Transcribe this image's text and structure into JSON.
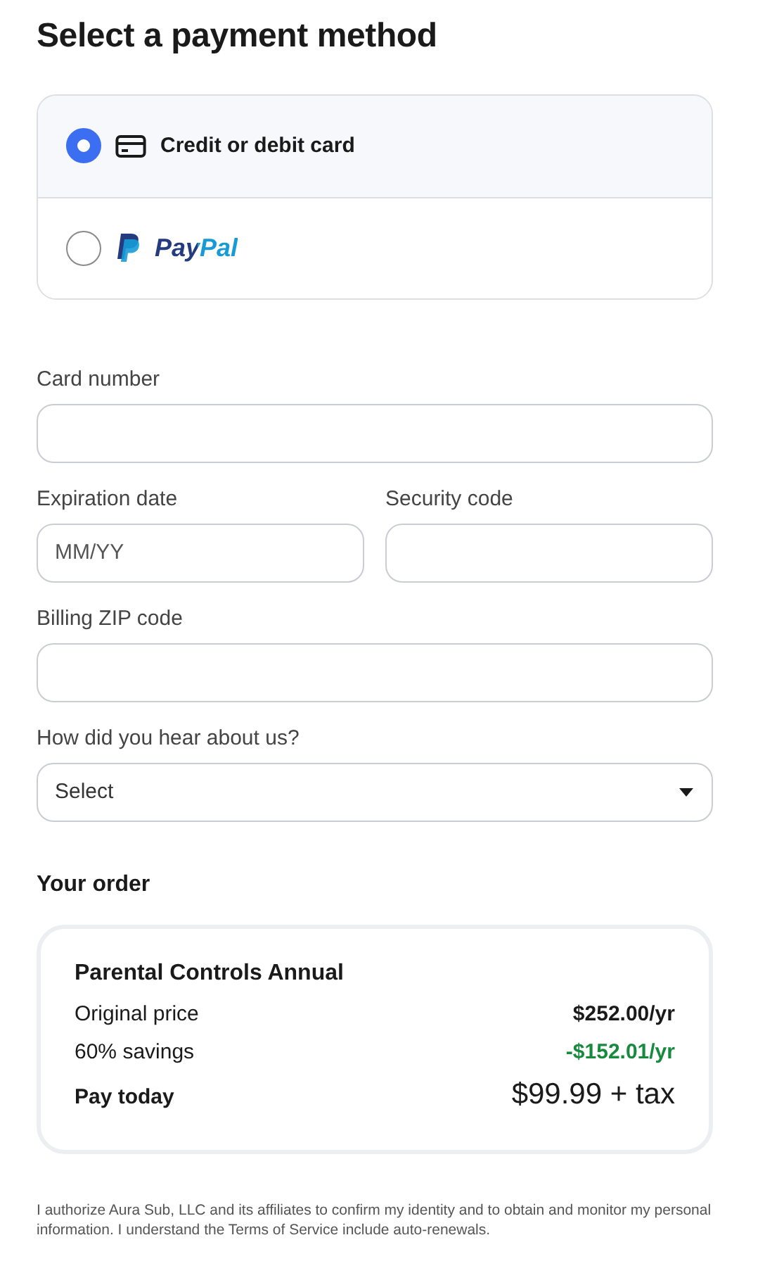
{
  "title": "Select a payment method",
  "payment_methods": [
    {
      "kind": "card",
      "label": "Credit or debit card",
      "selected": true
    },
    {
      "kind": "paypal",
      "label": "PayPal",
      "selected": false
    }
  ],
  "field_rows": [
    [
      {
        "kind": "text",
        "label": "Card number"
      }
    ],
    [
      {
        "kind": "text",
        "label": "Expiration date",
        "placeholder": "MM/YY"
      },
      {
        "kind": "text",
        "label": "Security code"
      }
    ],
    [
      {
        "kind": "text",
        "label": "Billing ZIP code"
      }
    ],
    [
      {
        "kind": "select",
        "label": "How did you hear about us?",
        "value": "Select"
      }
    ]
  ],
  "order": {
    "heading": "Your order",
    "product": "Parental Controls Annual",
    "lines": [
      {
        "kind": "price",
        "label": "Original price",
        "amount": "$252.00/yr"
      },
      {
        "kind": "savings",
        "label": "60% savings",
        "amount": "-$152.01/yr"
      },
      {
        "kind": "total",
        "label": "Pay today",
        "amount": "$99.99 + tax"
      }
    ]
  },
  "disclaimer": "I authorize Aura Sub, LLC and its affiliates to confirm my identity and to obtain and monitor my personal information. I understand the Terms of Service include auto-renewals."
}
